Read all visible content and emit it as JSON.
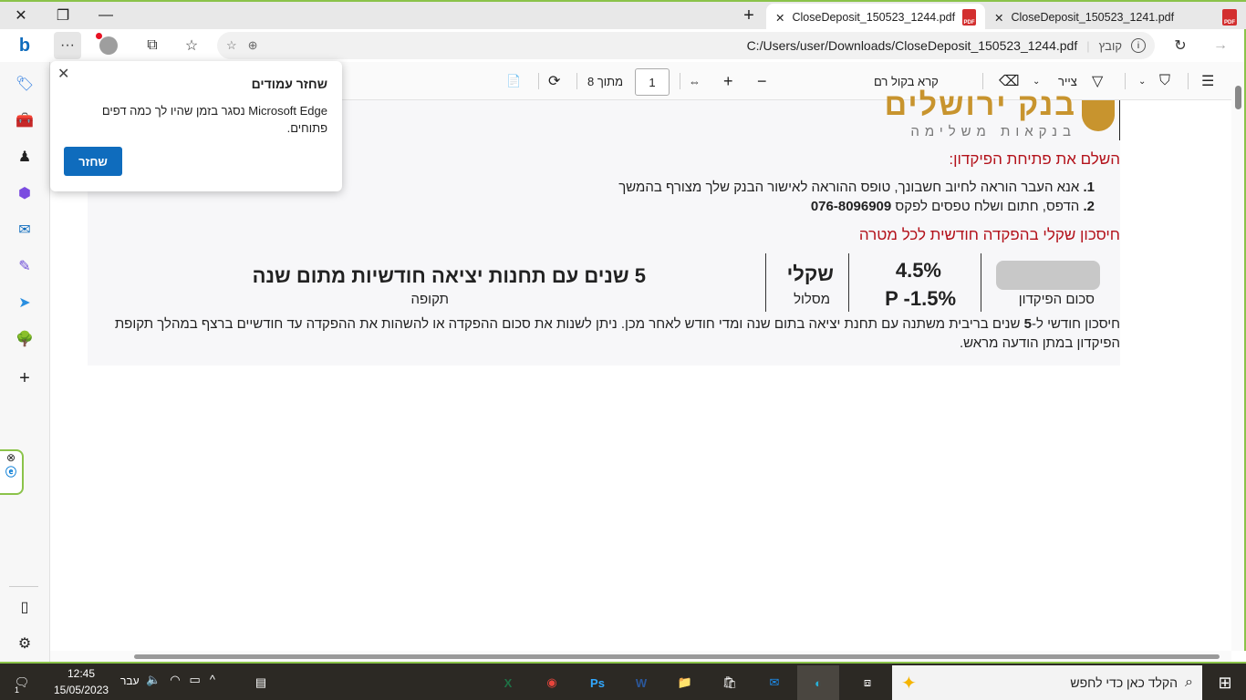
{
  "tabs": [
    {
      "title": "CloseDeposit_150523_1244.pdf",
      "active": true
    },
    {
      "title": "CloseDeposit_150523_1241.pdf",
      "active": false
    }
  ],
  "address": {
    "url": "C:/Users/user/Downloads/CloseDeposit_150523_1244.pdf",
    "scheme_label": "קובץ"
  },
  "pdf_toolbar": {
    "page_current": "1",
    "page_of": "מתוך 8",
    "read_aloud": "קרא בקול רם",
    "draw": "צייר"
  },
  "popup": {
    "title": "שחזר עמודים",
    "body": "Microsoft Edge  נסגר בזמן שהיו לך כמה דפים פתוחים.",
    "button": "שחזר"
  },
  "document": {
    "logo_text": "בנק ירושלים",
    "logo_sub": "בנקאות משלימה",
    "heading1": "השלם את פתיחת הפיקדון:",
    "steps": [
      {
        "num": "1.",
        "text": " אנא העבר הוראה לחיוב חשבונך, טופס ההוראה לאישור הבנק שלך מצורף בהמשך"
      },
      {
        "num": "2.",
        "text": " הדפס, חתום ושלח טפסים לפקס ",
        "fax": "076-8096909"
      }
    ],
    "heading2": "חיסכון שקלי בהפקדה חודשית לכל מטרה",
    "summary": {
      "amount_label": "סכום הפיקדון",
      "rate": "4.5%",
      "rate2": "P -1.5%",
      "track": "שקלי",
      "track_label": "מסלול",
      "period": "5 שנים עם תחנות יציאה חודשיות מתום שנה",
      "period_label": "תקופה"
    },
    "description_a": "חיסכון חודשי ל-",
    "description_b": "5",
    "description_c": " שנים בריבית משתנה עם תחנת יציאה בתום שנה ומדי חודש לאחר מכן. ניתן לשנות את סכום ההפקדה או להשהות את ההפקדה עד חודשיים ברצף במהלך תקופת הפיקדון במתן הודעה מראש."
  },
  "taskbar": {
    "time": "12:45",
    "date": "15/05/2023",
    "lang": "עבר",
    "search_placeholder": "הקלד כאן כדי לחפש",
    "notif_count": "1"
  },
  "colors": {
    "accent": "#0f6cbd",
    "heading_red": "#b3121b",
    "logo_gold": "#c8942e",
    "frame_green": "#8bc34a"
  }
}
